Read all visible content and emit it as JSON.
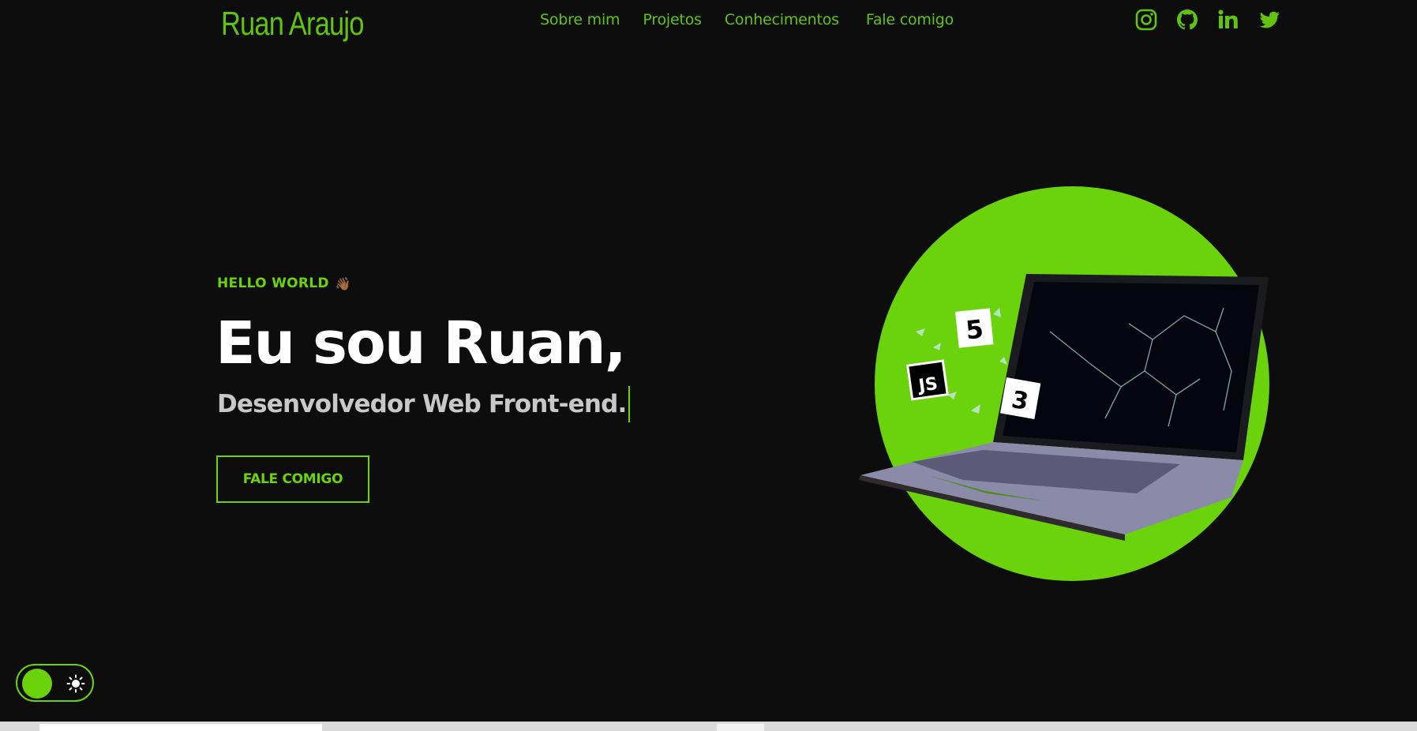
{
  "header": {
    "brand": "Ruan Araujo",
    "nav": [
      "Sobre mim",
      "Projetos",
      "Conhecimentos",
      "Fale comigo"
    ],
    "social": [
      "instagram-icon",
      "github-icon",
      "linkedin-icon",
      "twitter-icon"
    ]
  },
  "hero": {
    "eyebrow": "HELLO WORLD",
    "eyebrow_emoji": "👋🏾",
    "title": "Eu sou Ruan,",
    "subtitle": "Desenvolvedor Web Front-end.",
    "cta_label": "FALE COMIGO",
    "image_icons": [
      "html5-icon",
      "js-icon",
      "css3-icon"
    ],
    "image_badges": {
      "html5": "5",
      "js": "JS",
      "css3": "3"
    }
  },
  "theme_toggle": {
    "state": "dark",
    "icon": "sun-icon"
  },
  "colors": {
    "accent": "#6ad30b",
    "background": "#0d0d0d",
    "circle": "#6ad30b"
  }
}
